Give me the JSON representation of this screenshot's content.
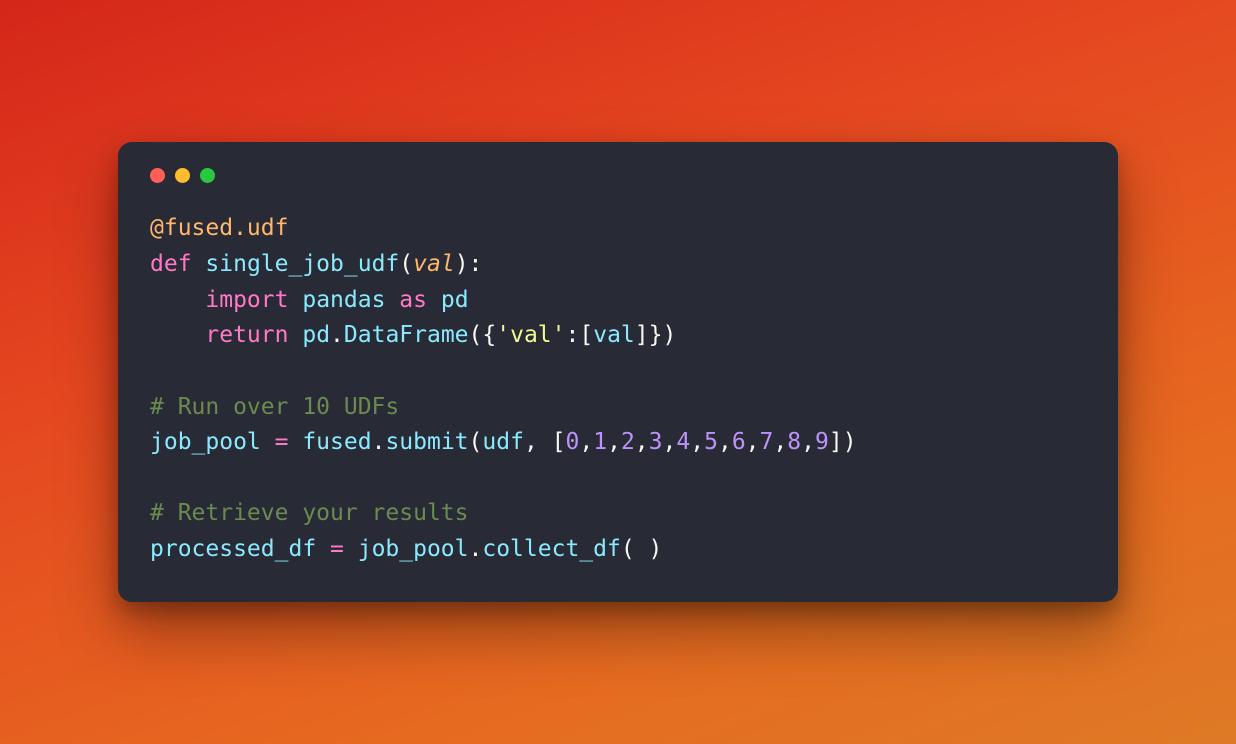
{
  "traffic_lights": {
    "close": "close",
    "minimize": "minimize",
    "zoom": "zoom"
  },
  "code": {
    "decorator_at": "@",
    "decorator_full": "@fused.udf",
    "kw_def": "def",
    "fn_name": "single_job_udf",
    "lp": "(",
    "param": "val",
    "rp_colon": "):",
    "indent": "    ",
    "kw_import": "import",
    "pandas": "pandas",
    "kw_as": "as",
    "pd_alias": "pd",
    "kw_return": "return",
    "pd": "pd",
    "dot": ".",
    "DataFrame": "DataFrame",
    "lp2": "(",
    "lbrace": "{",
    "str_val": "'val'",
    "colon": ":",
    "lbrack": "[",
    "param2": "val",
    "rbrack": "]",
    "rbrace": "}",
    "rp2": ")",
    "comment1": "# Run over 10 UDFs",
    "job_pool": "job_pool",
    "eq": " = ",
    "fused": "fused",
    "submit": "submit",
    "udf": "udf",
    "comma": ", ",
    "nums_open": "[",
    "n0": "0",
    "c": ",",
    "n1": "1",
    "n2": "2",
    "n3": "3",
    "n4": "4",
    "n5": "5",
    "n6": "6",
    "n7": "7",
    "n8": "8",
    "n9": "9",
    "nums_close": "]",
    "comment2": "# Retrieve your results",
    "processed_df": "processed_df",
    "collect_df": "collect_df",
    "empty_call": "( )"
  }
}
